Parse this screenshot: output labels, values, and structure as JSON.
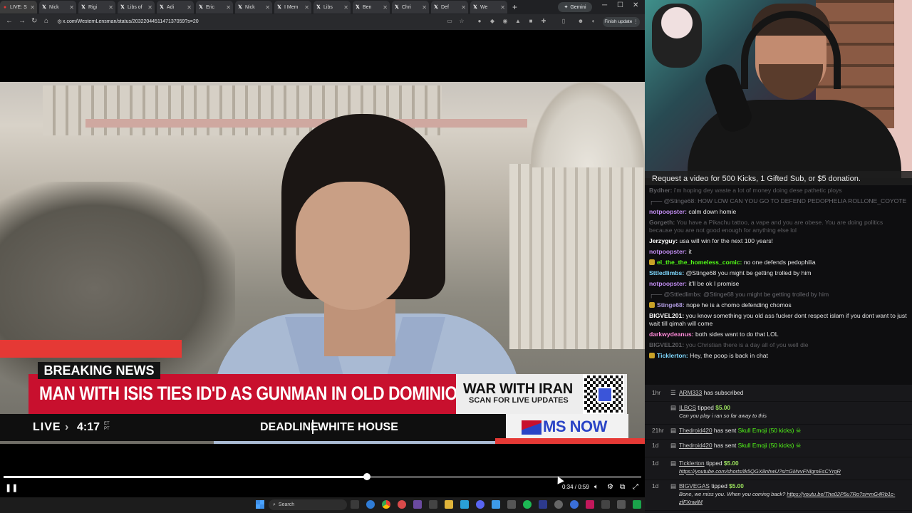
{
  "browser": {
    "tabs": [
      {
        "icon": "live-icon",
        "label": "LIVE: S",
        "color": "#e53935"
      },
      {
        "icon": "x-icon",
        "label": "Nick",
        "color": "#ffffff"
      },
      {
        "icon": "x-icon",
        "label": "Rigi",
        "color": "#ffffff"
      },
      {
        "icon": "x-icon",
        "label": "Libs of",
        "color": "#ffffff"
      },
      {
        "icon": "x-icon",
        "label": "Adi",
        "color": "#ffffff"
      },
      {
        "icon": "x-icon",
        "label": "Eric",
        "color": "#ffffff"
      },
      {
        "icon": "x-icon",
        "label": "Nick",
        "color": "#ffffff"
      },
      {
        "icon": "x-icon",
        "label": "I Mem",
        "color": "#ffffff"
      },
      {
        "icon": "x-icon",
        "label": "Libs",
        "color": "#ffffff"
      },
      {
        "icon": "x-icon",
        "label": "Ben",
        "color": "#ffffff"
      },
      {
        "icon": "x-icon",
        "label": "Chri",
        "color": "#ffffff"
      },
      {
        "icon": "x-icon",
        "label": "Def",
        "color": "#ffffff"
      },
      {
        "icon": "x-icon",
        "label": "We",
        "color": "#ffffff"
      }
    ],
    "gemini_label": "Gemini",
    "url": "x.com/WesternLensman/status/2032204451147137059?s=20",
    "finish_update_label": "Finish update"
  },
  "video": {
    "breaking_label": "BREAKING NEWS",
    "headline": "MAN WITH ISIS TIES ID'D AS GUNMAN IN OLD DOMINION UNIV. SHOOTING",
    "side_title": "WAR WITH IRAN",
    "side_sub": "SCAN FOR LIVE UPDATES",
    "live_label": "LIVE",
    "live_time": "4:17",
    "live_tz": "ET PT",
    "show_name": "DEADLINE",
    "show_location": "WHITE HOUSE",
    "network": "MS NOW",
    "timecode": "0:34 / 0:59",
    "progress": 0.57
  },
  "taskbar": {
    "search_label": "Search"
  },
  "stream": {
    "banner": "Request a video for 500 Kicks, 1 Gifted Sub, or $5 donation.",
    "chat": [
      {
        "user": "Bydher:",
        "text": "i'm hoping dey waste a lot of money doing dese pathetic ploys",
        "color": "#b09be0",
        "dim": true,
        "reply": false
      },
      {
        "user": "",
        "text": "@Stinge68: HOW LOW CAN YOU GO TO DEFEND PEDOPHELIA ROLLONE_COYOTE",
        "color": "#777",
        "dim": true,
        "reply": true
      },
      {
        "user": "notpoopster:",
        "text": "calm down homie",
        "color": "#c28df2",
        "dim": false,
        "reply": false
      },
      {
        "user": "Gorgeth:",
        "text": "You have a Pikachu tattoo, a vape and you are obese. You are doing politics because you are not good enough for anything else lol",
        "color": "#5e5e62",
        "dim": true,
        "reply": false
      },
      {
        "user": "Jerzyguy:",
        "text": "usa will win for the next 100 years!",
        "color": "#ffffff",
        "dim": false,
        "reply": false
      },
      {
        "user": "notpoopster:",
        "text": "it",
        "color": "#c28df2",
        "dim": false,
        "reply": false
      },
      {
        "user": "el_the_the_homeless_comic:",
        "text": "no one defends pedophilia",
        "color": "#53fc18",
        "dim": false,
        "reply": false,
        "badge": "#c9a227"
      },
      {
        "user": "Sttledlimbs:",
        "text": "@Stinge68 you might be getting trolled by him",
        "color": "#7fd8ff",
        "dim": false,
        "reply": false
      },
      {
        "user": "notpoopster:",
        "text": "it'll be ok I promise",
        "color": "#c28df2",
        "dim": false,
        "reply": false
      },
      {
        "user": "",
        "text": "@Sttledlimbs: @Stinge68 you might be getting trolled by him",
        "color": "#777",
        "dim": true,
        "reply": true
      },
      {
        "user": "Stinge68:",
        "text": "nope he is a chomo defending chomos",
        "color": "#b09be0",
        "dim": false,
        "reply": false,
        "badge": "#c9a227"
      },
      {
        "user": "BIGVEL201:",
        "text": "you know something you old ass fucker dont respect islam if you dont want to just wait till qimah will come",
        "color": "#ffffff",
        "dim": false,
        "reply": false
      },
      {
        "user": "darkwydeanus:",
        "text": "both sides want to do that LOL",
        "color": "#ff8ad8",
        "dim": false,
        "reply": false
      },
      {
        "user": "BIGVEL201:",
        "text": "you Christian there is a day all of you well die",
        "color": "#5e5e62",
        "dim": true,
        "reply": false
      },
      {
        "user": "Ticklerton:",
        "text": "Hey, the poop is back in chat",
        "color": "#7fd8ff",
        "dim": false,
        "reply": false,
        "badge": "#c9a227"
      }
    ],
    "events": [
      {
        "time": "1hr",
        "icon": "user-icon",
        "name": "ARM333",
        "action": "has subscribed",
        "amount": "",
        "gift": "",
        "message": "",
        "link": ""
      },
      {
        "time": "",
        "icon": "cash-icon",
        "name": "ILBCS",
        "action": "tipped",
        "amount": "$5.00",
        "gift": "",
        "message": "Can you play i ran so far away to this",
        "link": ""
      },
      {
        "time": "21hr",
        "icon": "cash-icon",
        "name": "Thedroid420",
        "action": "has sent",
        "amount": "",
        "gift": "Skull Emoji (50 kicks)",
        "message": "",
        "link": ""
      },
      {
        "time": "1d",
        "icon": "cash-icon",
        "name": "Thedroid420",
        "action": "has sent",
        "amount": "",
        "gift": "Skull Emoji (50 kicks)",
        "message": "",
        "link": ""
      },
      {
        "time": "1d",
        "icon": "cash-icon",
        "name": "Ticklerton",
        "action": "tipped",
        "amount": "$5.00",
        "gift": "",
        "message": "",
        "link": "https://youtube.com/shorts/tk5QGX8nhwU?si=GMvvFNlgmEsCYrgR"
      },
      {
        "time": "1d",
        "icon": "cash-icon",
        "name": "BIGVEGAS",
        "action": "tipped",
        "amount": "$5.00",
        "gift": "",
        "message": "Bone, we miss you. When you coming back?",
        "link": "https://youtu.be/The02P5u7Ro?si=mG4Rb1c-zfFXnwlM"
      }
    ]
  }
}
